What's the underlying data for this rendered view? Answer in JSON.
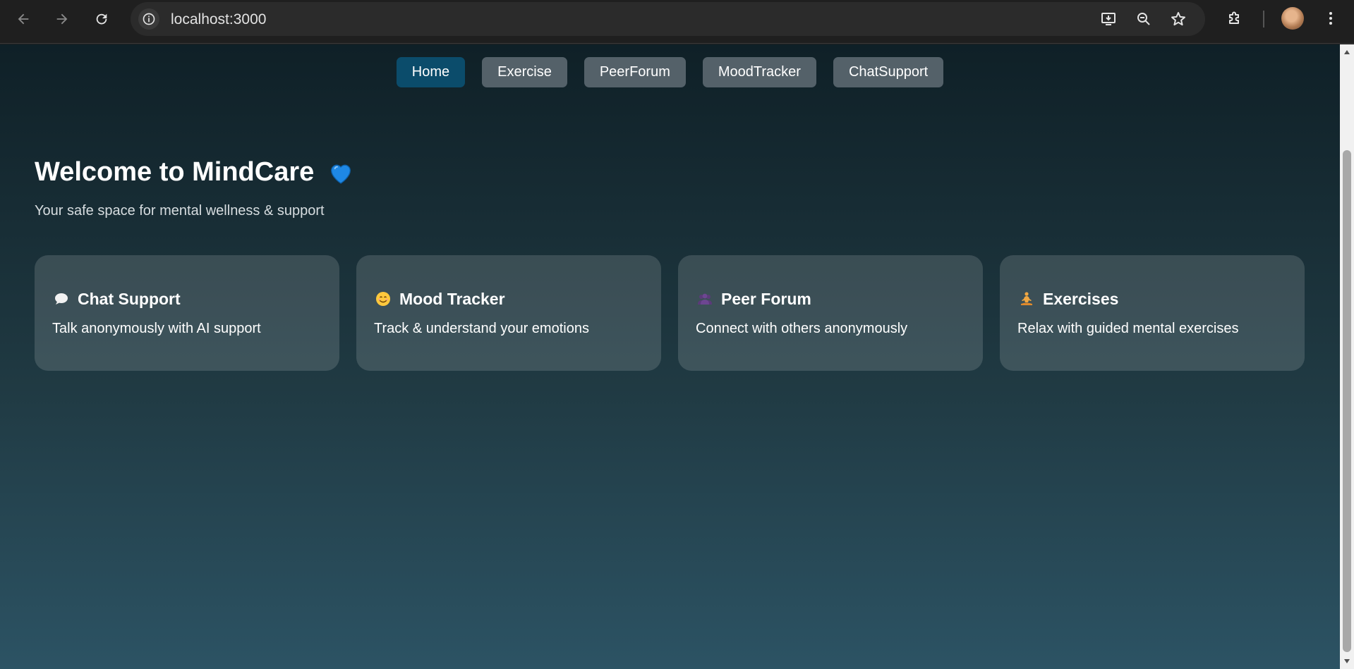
{
  "browser": {
    "url": "localhost:3000",
    "back_icon": "arrow-left-icon",
    "forward_icon": "arrow-right-icon",
    "reload_icon": "reload-icon",
    "site_info_icon": "info-icon",
    "install_icon": "install-app-icon",
    "zoom_icon": "zoom-out-icon",
    "bookmark_icon": "star-icon",
    "extensions_icon": "puzzle-icon",
    "menu_icon": "kebab-menu-icon"
  },
  "nav": {
    "active": "Home",
    "links": [
      "Home",
      "Exercise",
      "PeerForum",
      "MoodTracker",
      "ChatSupport"
    ]
  },
  "hero": {
    "title": "Welcome to MindCare",
    "subtitle": "Your safe space for mental wellness & support"
  },
  "cards": [
    {
      "icon": "speech-bubble-icon",
      "title": "Chat Support",
      "desc": "Talk anonymously with AI support"
    },
    {
      "icon": "smiling-face-icon",
      "title": "Mood Tracker",
      "desc": "Track & understand your emotions"
    },
    {
      "icon": "people-icon",
      "title": "Peer Forum",
      "desc": "Connect with others anonymously"
    },
    {
      "icon": "meditation-icon",
      "title": "Exercises",
      "desc": "Relax with guided mental exercises"
    }
  ],
  "colors": {
    "bg_top": "#0f2027",
    "bg_mid": "#203a43",
    "bg_bottom": "#2c5364",
    "nav_active": "#0b4c6b",
    "nav_default": "#546169",
    "heart": "#1e88e5"
  }
}
